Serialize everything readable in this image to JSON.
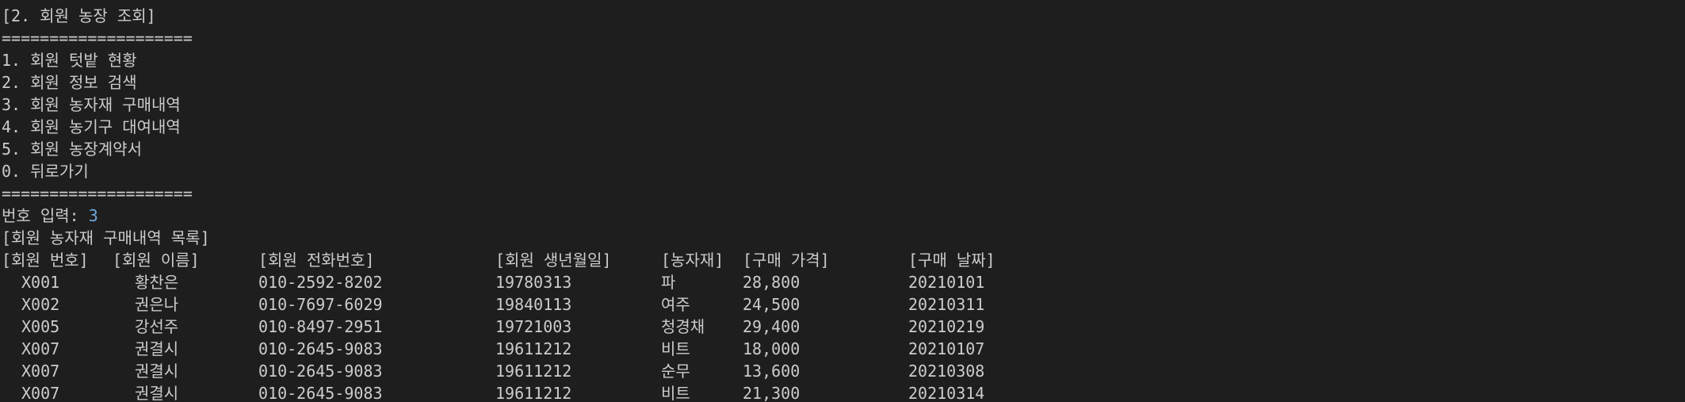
{
  "console": {
    "title_line": "[2. 회원 농장 조회]",
    "separator": "====================",
    "menu": [
      "1. 회원 텃밭 현황",
      "2. 회원 정보 검색",
      "3. 회원 농자재 구매내역",
      "4. 회원 농기구 대여내역",
      "5. 회원 농장계약서",
      "0. 뒤로가기"
    ],
    "prompt_label": "번호 입력: ",
    "prompt_value": "3",
    "list_title": "[회원 농자재 구매내역 목록]",
    "headers": [
      "[회원 번호]",
      "[회원 이름]",
      "[회원 전화번호]",
      "[회원 생년월일]",
      "[농자재]",
      "[구매 가격]",
      "[구매 날짜]"
    ],
    "rows": [
      [
        "X001",
        "황찬은",
        "010-2592-8202",
        "19780313",
        "파",
        "28,800",
        "20210101"
      ],
      [
        "X002",
        "권은나",
        "010-7697-6029",
        "19840113",
        "여주",
        "24,500",
        "20210311"
      ],
      [
        "X005",
        "강선주",
        "010-8497-2951",
        "19721003",
        "청경채",
        "29,400",
        "20210219"
      ],
      [
        "X007",
        "권결시",
        "010-2645-9083",
        "19611212",
        "비트",
        "18,000",
        "20210107"
      ],
      [
        "X007",
        "권결시",
        "010-2645-9083",
        "19611212",
        "순무",
        "13,600",
        "20210308"
      ],
      [
        "X007",
        "권결시",
        "010-2645-9083",
        "19611212",
        "비트",
        "21,300",
        "20210314"
      ]
    ]
  }
}
